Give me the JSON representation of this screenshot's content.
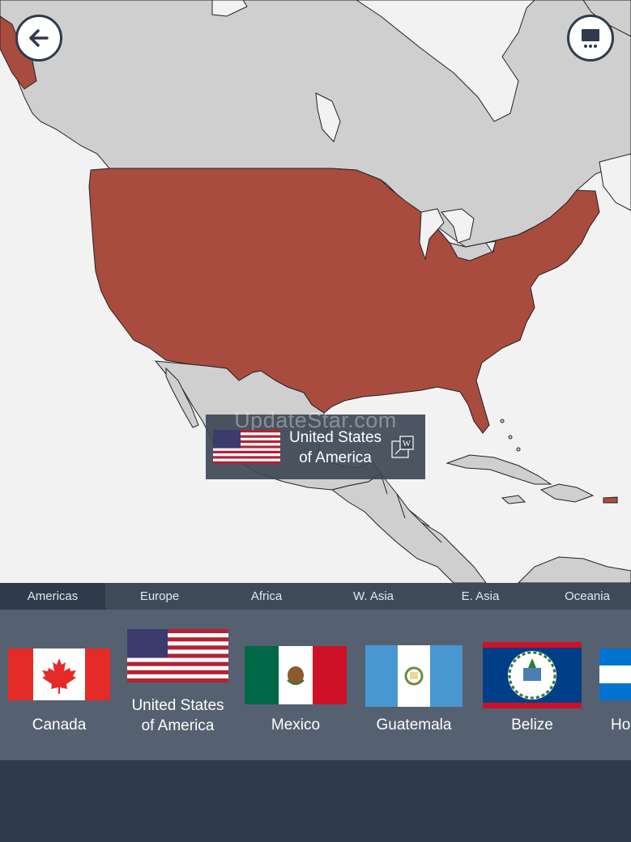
{
  "tooltip": {
    "country_name_line1": "United States",
    "country_name_line2": "of America",
    "watermark": "UpdateStar.com",
    "wiki_icon": "wikipedia-link-icon"
  },
  "buttons": {
    "back_icon": "arrow-left-icon",
    "screen_icon": "screen-menu-icon"
  },
  "tabs": [
    {
      "label": "Americas",
      "active": true
    },
    {
      "label": "Europe",
      "active": false
    },
    {
      "label": "Africa",
      "active": false
    },
    {
      "label": "W. Asia",
      "active": false
    },
    {
      "label": "E. Asia",
      "active": false
    },
    {
      "label": "Oceania",
      "active": false
    }
  ],
  "countries": [
    {
      "line1": "Canada",
      "line2": ""
    },
    {
      "line1": "United States",
      "line2": "of America"
    },
    {
      "line1": "Mexico",
      "line2": ""
    },
    {
      "line1": "Guatemala",
      "line2": ""
    },
    {
      "line1": "Belize",
      "line2": ""
    },
    {
      "line1": "Ho",
      "line2": ""
    }
  ],
  "colors": {
    "highlight": "#a94c3f",
    "land": "#cfcfcf",
    "sea": "#f2f2f2",
    "panel": "#556170",
    "tabbar": "#3f4a58",
    "dark": "#2f3b4a"
  }
}
